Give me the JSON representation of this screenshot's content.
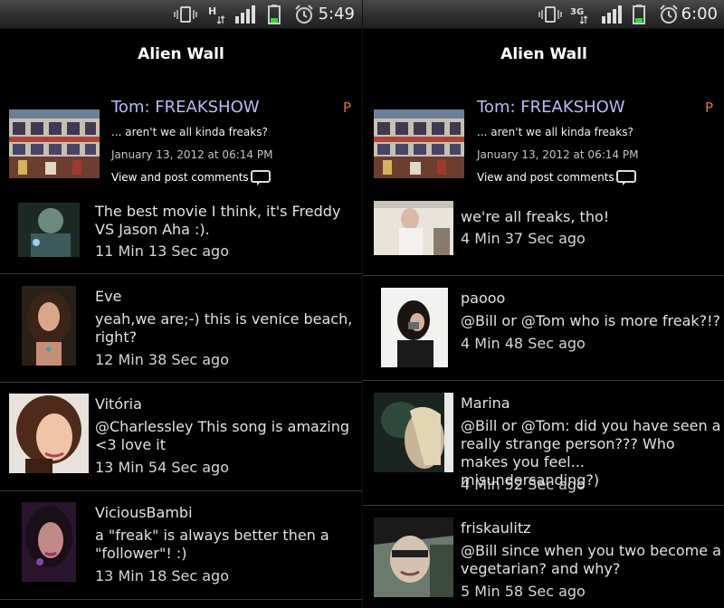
{
  "colors": {
    "background": "#000000",
    "username": "#b8bcf6",
    "badge": "#e8741c",
    "battery": "#39d53c",
    "status_bar": "#3a3a3a"
  },
  "screens": [
    {
      "status": {
        "time": "5:49",
        "network": "H",
        "icons": [
          "vibrate-icon",
          "network-h-icon",
          "signal-icon",
          "battery-icon",
          "alarm-icon"
        ]
      },
      "title": "Alien Wall",
      "post": {
        "user": "Tom: FREAKSHOW",
        "badge": "P",
        "text": "... aren't we all kinda freaks?",
        "date": "January 13, 2012 at 06:14 PM",
        "view_label": "View and post comments"
      },
      "comments": [
        {
          "name": "",
          "text_lines": [
            "The best movie I think, it's Freddy",
            "VS Jason Aha :)."
          ],
          "time": "11 Min 13 Sec ago"
        },
        {
          "name": "Eve",
          "text_lines": [
            "yeah,we are;-) this is venice beach,",
            "right?"
          ],
          "time": "12 Min 38 Sec ago"
        },
        {
          "name": "Vitória",
          "text_lines": [
            "@Charlessley This song is amazing",
            "<3 love it"
          ],
          "time": "13 Min 54 Sec ago"
        },
        {
          "name": "ViciousBambi",
          "text_lines": [
            "a \"freak\" is always better then a",
            "\"follower\"! :)"
          ],
          "time": "13 Min 18 Sec ago"
        }
      ]
    },
    {
      "status": {
        "time": "6:00",
        "network": "3G",
        "icons": [
          "vibrate-icon",
          "network-3g-icon",
          "signal-icon",
          "battery-icon",
          "alarm-icon"
        ]
      },
      "title": "Alien Wall",
      "post": {
        "user": "Tom: FREAKSHOW",
        "badge": "P",
        "text": "... aren't we all kinda freaks?",
        "date": "January 13, 2012 at 06:14 PM",
        "view_label": "View and post comments"
      },
      "comments": [
        {
          "name": "",
          "text_lines": [
            "we're all freaks, tho!"
          ],
          "time": "4 Min 37 Sec ago"
        },
        {
          "name": "paooo",
          "text_lines": [
            "@Bill or @Tom who is more freak?!?"
          ],
          "time": "4 Min 48 Sec ago"
        },
        {
          "name": "Marina",
          "text_lines": [
            "@Bill or @Tom: did you have seen a",
            "really strange person??? Who",
            "makes you feel... misundersanding?)"
          ],
          "time": "4 Min 52 Sec ago"
        },
        {
          "name": "friskaulitz",
          "text_lines": [
            "@Bill since when you two become a",
            "vegetarian? and why?"
          ],
          "time": "5 Min 58 Sec ago"
        }
      ]
    }
  ]
}
